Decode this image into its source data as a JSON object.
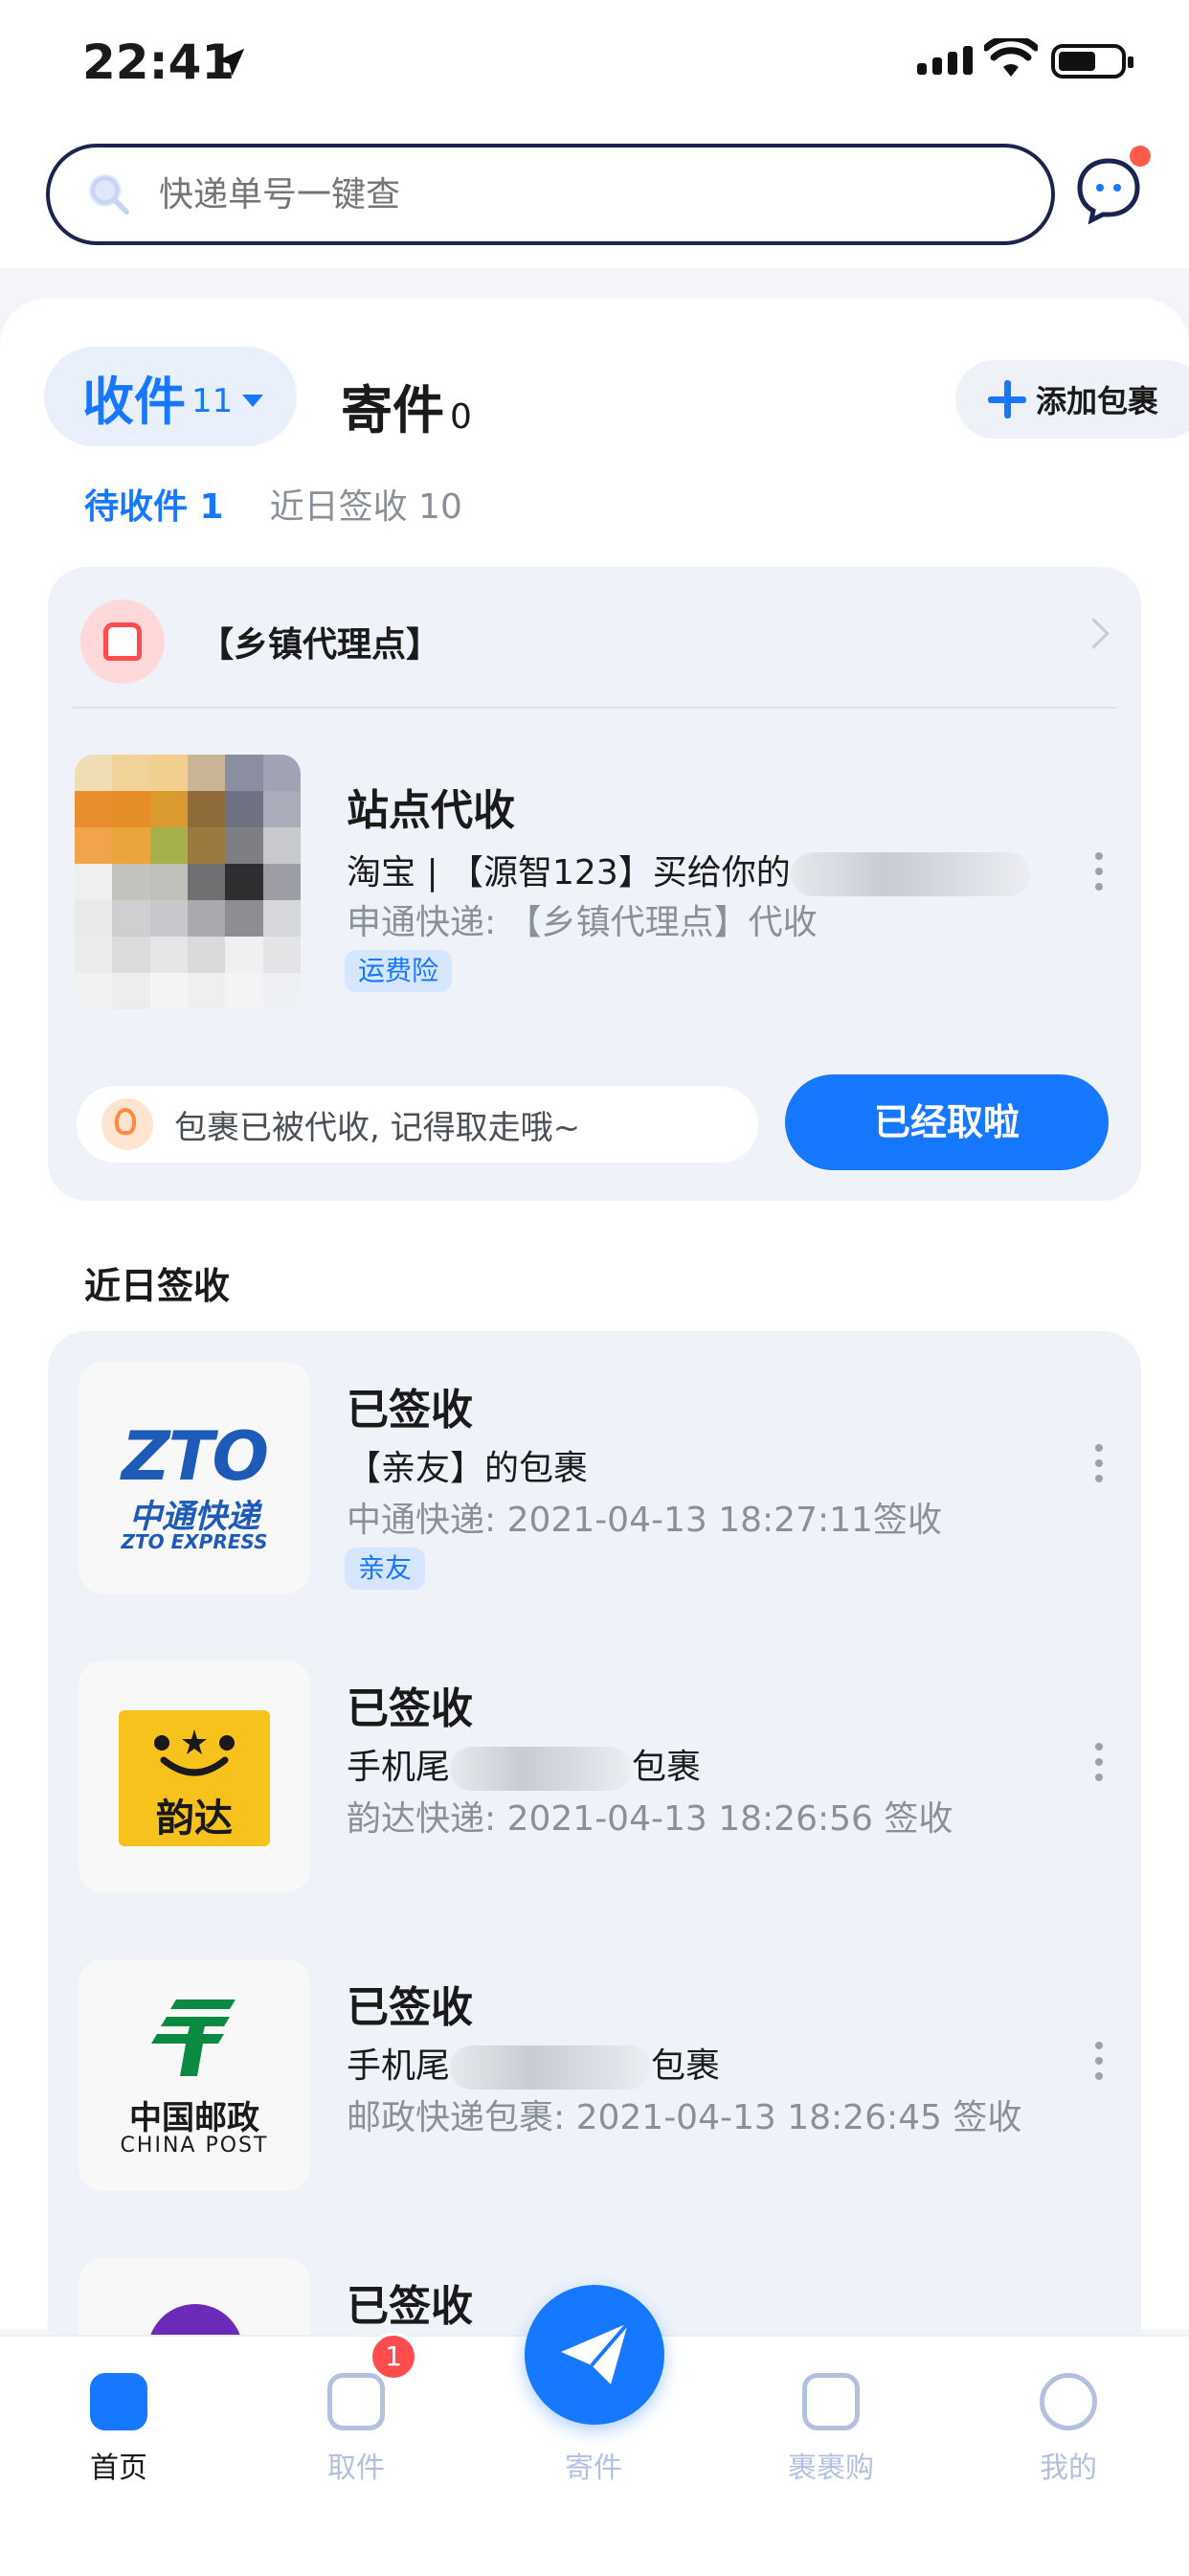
{
  "status_bar": {
    "time": "22:41"
  },
  "search": {
    "placeholder": "快递单号一键查"
  },
  "tabs": {
    "receive": {
      "label": "收件",
      "count": "11"
    },
    "send": {
      "label": "寄件",
      "count": "0"
    },
    "add_button": "添加包裹"
  },
  "subtabs": {
    "pending": "待收件 1",
    "recent": "近日签收 10"
  },
  "pending_card": {
    "station": "【乡镇代理点】",
    "title": "站点代收",
    "desc_prefix": "淘宝 | 【源智123】买给你的",
    "sub": "申通快递: 【乡镇代理点】代收",
    "badge": "运费险",
    "notice": "包裹已被代收, 记得取走哦~",
    "action": "已经取啦"
  },
  "recent_section_title": "近日签收",
  "recent_items": [
    {
      "title": "已签收",
      "desc": "【亲友】的包裹",
      "sub": "中通快递: 2021-04-13 18:27:11签收",
      "badge": "亲友",
      "logo_main": "ZTO",
      "logo_cn": "中通快递",
      "logo_en": "ZTO EXPRESS"
    },
    {
      "title": "已签收",
      "desc_prefix": "手机尾",
      "desc_suffix": "包裹",
      "sub": "韵达快递: 2021-04-13 18:26:56 签收",
      "logo_cn": "韵达"
    },
    {
      "title": "已签收",
      "desc_prefix": "手机尾",
      "desc_suffix": "包裹",
      "sub": "邮政快递包裹: 2021-04-13 18:26:45 签收",
      "logo_cn": "中国邮政",
      "logo_en": "CHINA POST"
    },
    {
      "title": "已签收"
    }
  ],
  "bottom_nav": {
    "home": "首页",
    "pickup": "取件",
    "pickup_badge": "1",
    "send": "寄件",
    "shop": "裹裹购",
    "mine": "我的"
  },
  "colors": {
    "accent": "#1677ff",
    "badge_red": "#ff4d4f",
    "card_bg": "#eff3f9"
  }
}
